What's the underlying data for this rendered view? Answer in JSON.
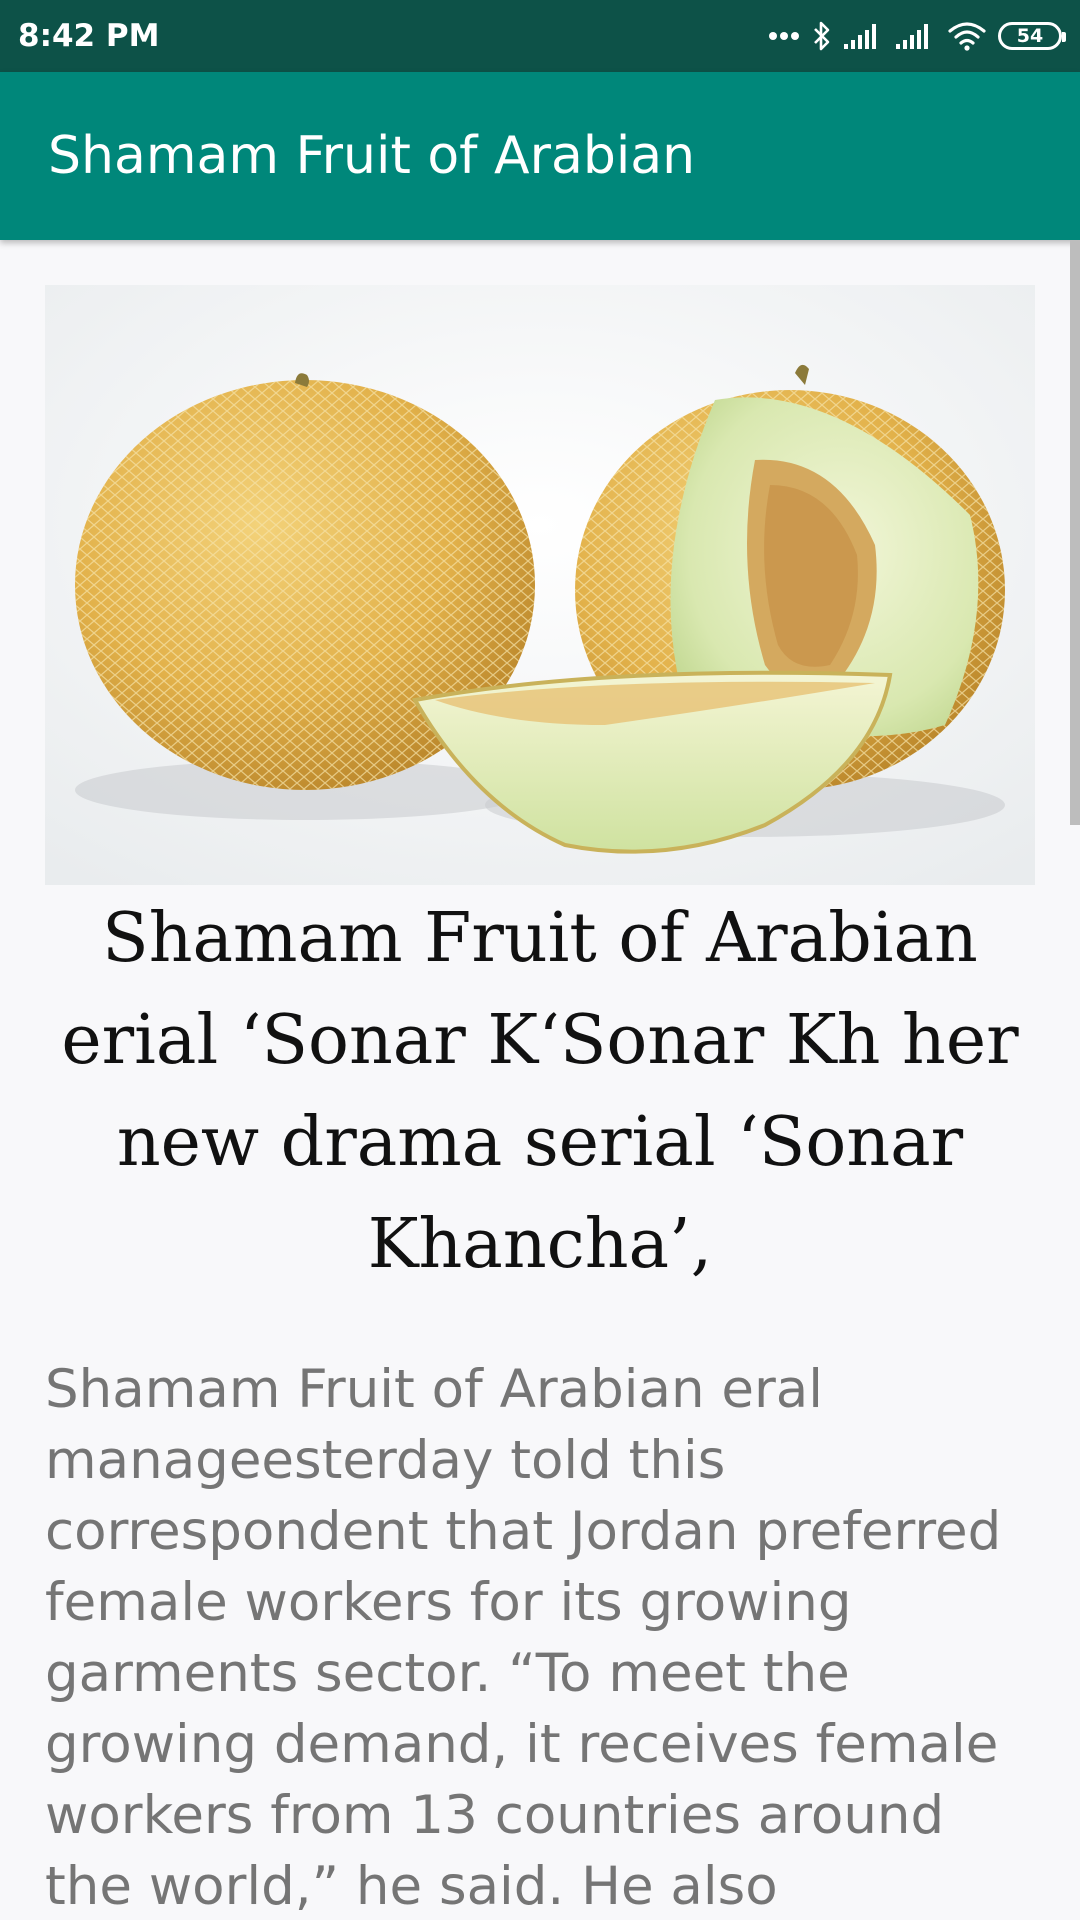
{
  "status_bar": {
    "time": "8:42 PM",
    "battery_level": "54",
    "icons": [
      "more-dots-icon",
      "bluetooth-icon",
      "signal-icon",
      "signal-icon",
      "wifi-icon",
      "battery-icon"
    ]
  },
  "app_bar": {
    "title": "Shamam Fruit of Arabian",
    "color": "#00877a"
  },
  "article": {
    "image": "melon-photo",
    "title": "Shamam Fruit of Arabian erial ‘Sonar K‘Sonar Kh her new drama serial ‘Sonar Khancha’,",
    "body": "Shamam Fruit of Arabian eral manageesterday told this correspondent that Jordan preferred female workers for its growing garments sector. “To meet the growing demand, it receives female workers from 13 countries around the world,” he said. He also"
  },
  "colors": {
    "status_bar": "#0d5248",
    "app_bar": "#00877a",
    "background": "#f8f8fa",
    "title_text": "#111111",
    "body_text": "#757575"
  }
}
